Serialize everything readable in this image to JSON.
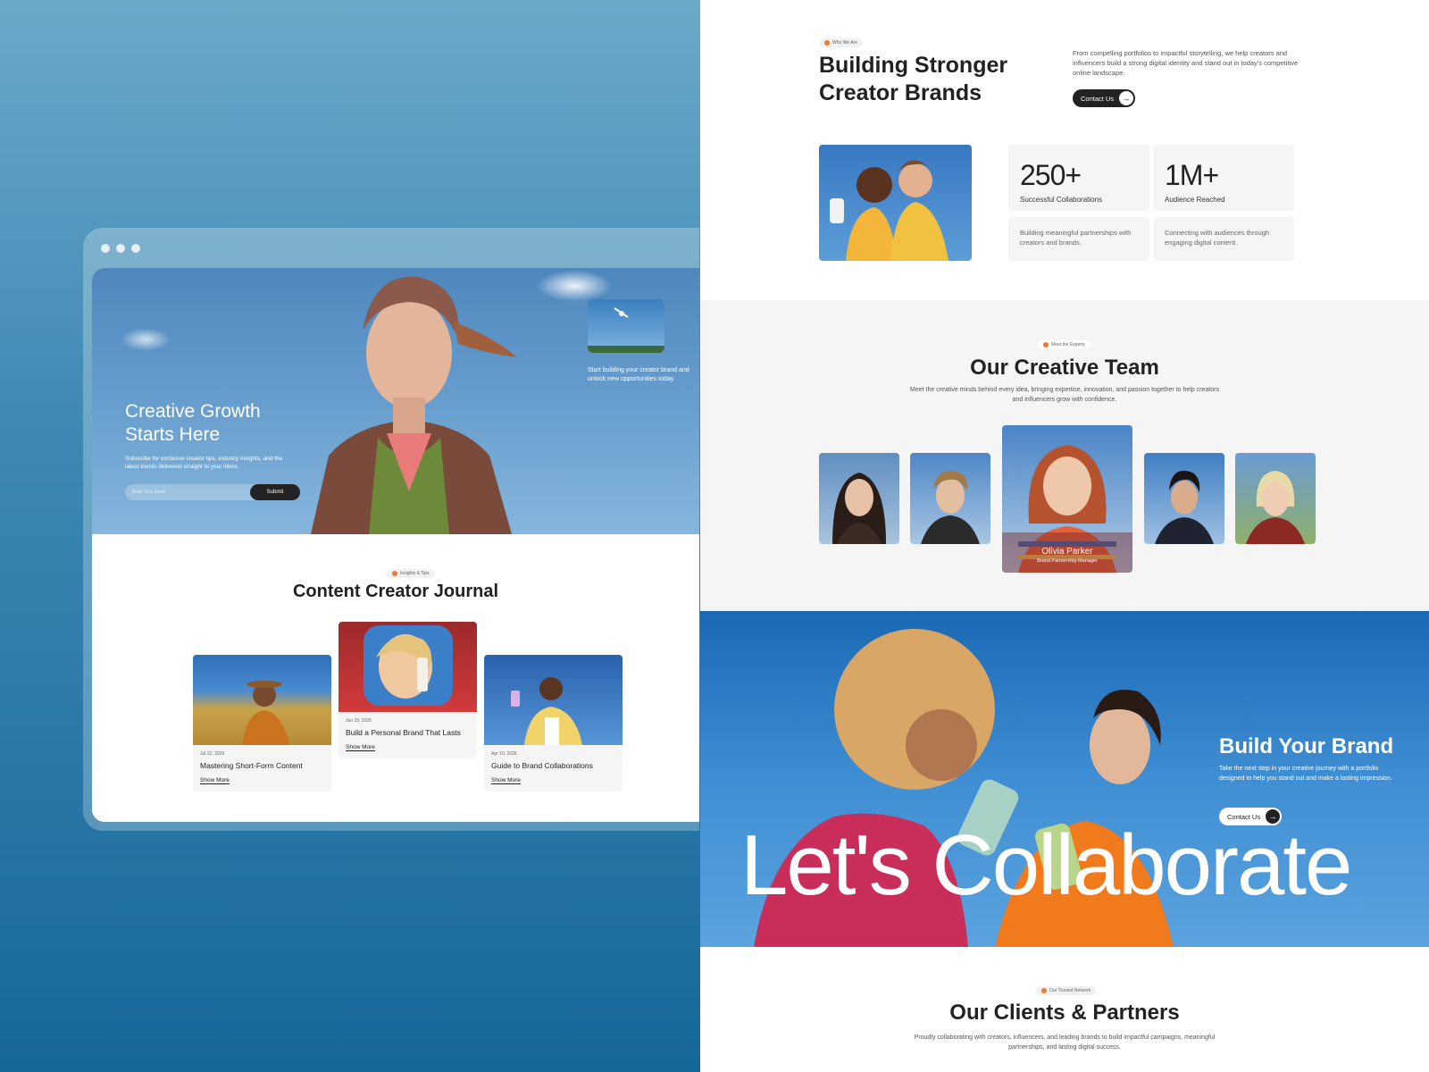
{
  "mockup": {
    "hero": {
      "title": "Creative Growth Starts Here",
      "subtitle": "Subscribe for exclusive creator tips, industry insights, and the latest trends delivered straight to your inbox.",
      "email_placeholder": "Enter Your Email",
      "submit_label": "Submit",
      "side_text": "Start building your creator brand and unlock new opportunities today."
    },
    "journal": {
      "badge": "Insights & Tips",
      "title": "Content Creator Journal",
      "cards": [
        {
          "date": "Jul 22, 2026",
          "title": "Mastering Short-Form Content",
          "link": "Show More"
        },
        {
          "date": "Jun 15, 2026",
          "title": "Build a Personal Brand That Lasts",
          "link": "Show More"
        },
        {
          "date": "Apr 10, 2026",
          "title": "Guide to Brand Collaborations",
          "link": "Show More"
        }
      ]
    }
  },
  "about": {
    "badge": "Who We Are",
    "title": "Building Stronger Creator Brands",
    "text": "From compelling portfolios to impactful storytelling, we help creators and influencers build a strong digital identity and stand out in today's competitive online landscape.",
    "cta": "Contact Us",
    "stats": [
      {
        "value": "250+",
        "label": "Successful Collaborations",
        "desc": "Building meaningful partnerships with creators and brands."
      },
      {
        "value": "1M+",
        "label": "Audience Reached",
        "desc": "Connecting with audiences through engaging digital content."
      }
    ]
  },
  "team": {
    "badge": "Meet the Experts",
    "title": "Our Creative Team",
    "subtitle": "Meet the creative minds behind every idea, bringing expertise, innovation, and passion together to help creators and influencers grow with confidence.",
    "featured": {
      "name": "Olivia Parker",
      "role": "Brand Partnership Manager"
    }
  },
  "collab": {
    "title": "Build Your Brand",
    "text": "Take the next step in your creative journey with a portfolio designed to help you stand out and make a lasting impression.",
    "cta": "Contact Us",
    "big_text": "Let's Collaborate"
  },
  "clients": {
    "badge": "Our Trusted Network",
    "title": "Our Clients & Partners",
    "subtitle": "Proudly collaborating with creators, influencers, and leading brands to build impactful campaigns, meaningful partnerships, and lasting digital success."
  },
  "colors": {
    "accent": "#f07a2f",
    "dark": "#222222",
    "background_blue": "#16679a"
  },
  "icons": [
    "arrow-right-icon",
    "badge-dot-icon",
    "window-dot-icon"
  ]
}
